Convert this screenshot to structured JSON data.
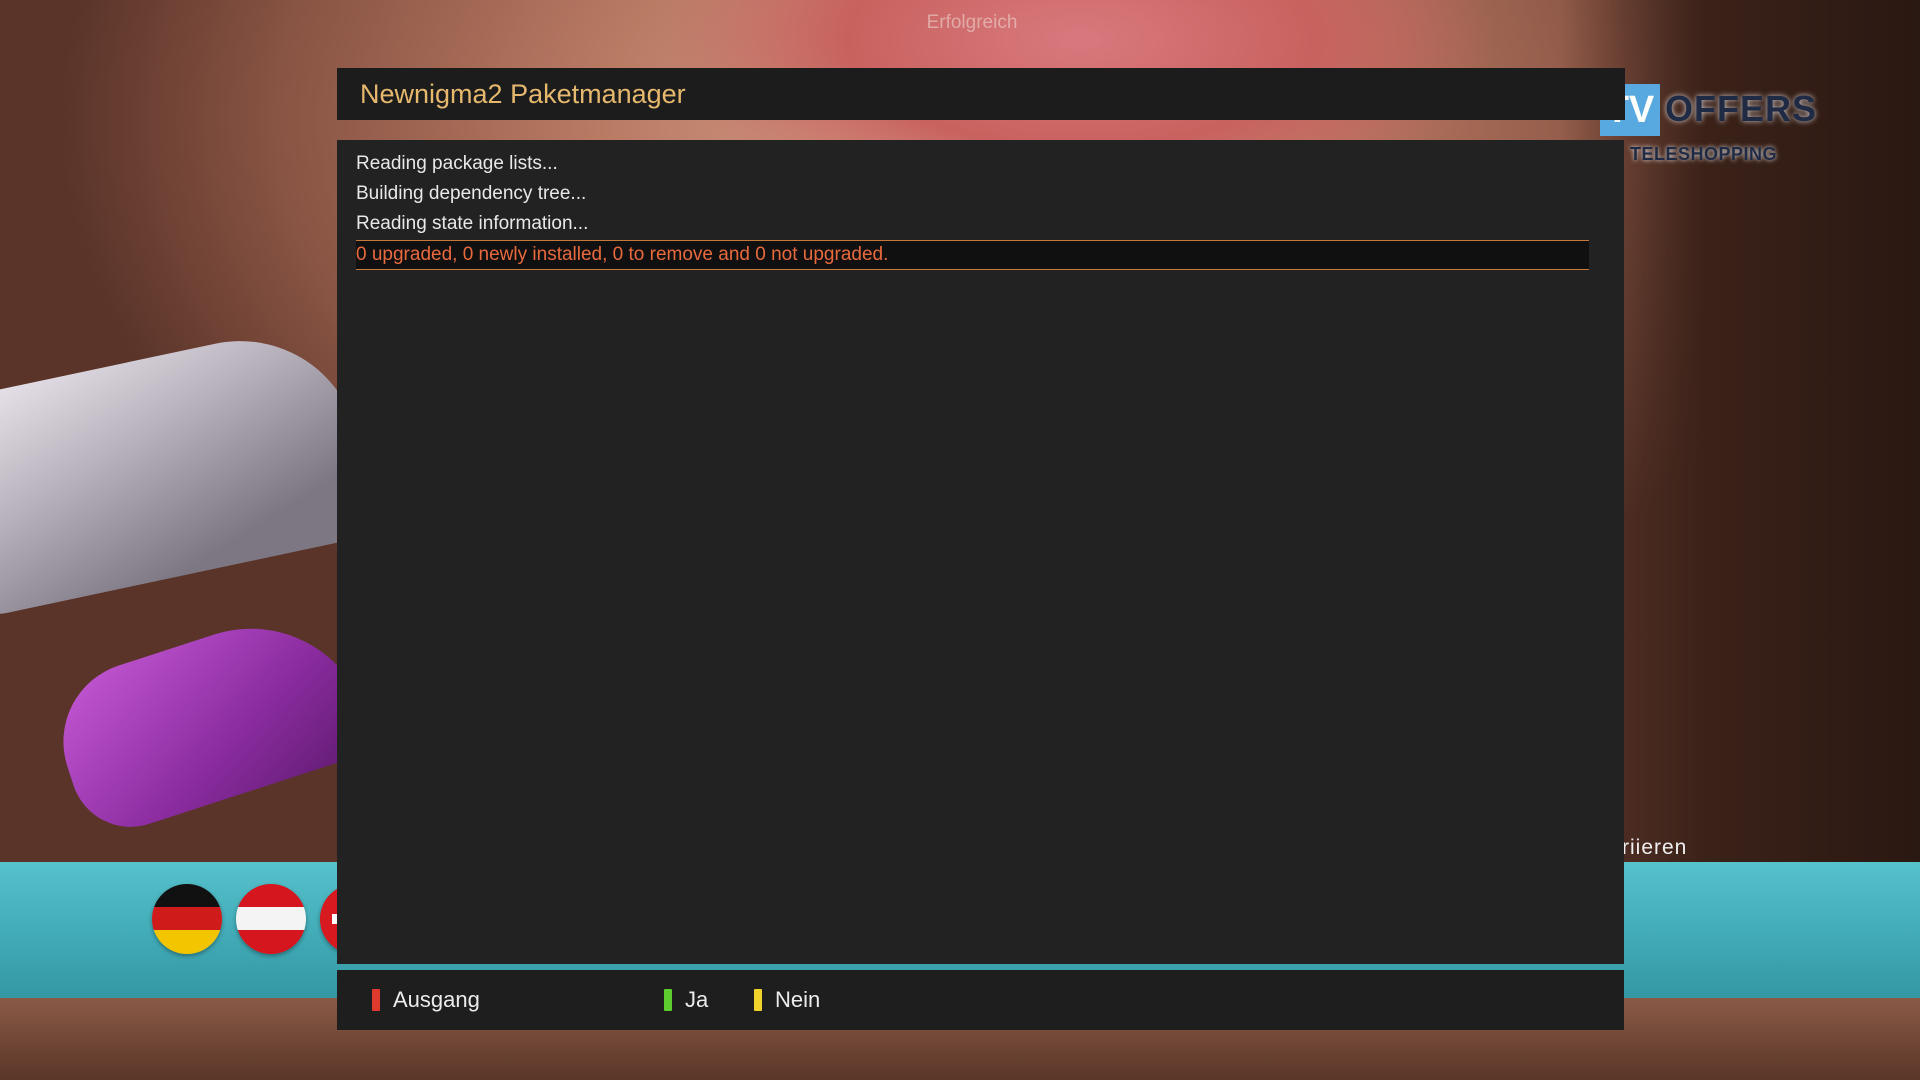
{
  "background": {
    "top_status": "Erfolgreich",
    "channel_logo": {
      "box_text": "TV",
      "word": "OFFERS",
      "sub": "TELESHOPPING"
    },
    "caption_fragment": "riieren"
  },
  "dialog": {
    "title": "Newnigma2 Paketmanager",
    "log_lines": [
      "Reading package lists...",
      "Building dependency tree...",
      "Reading state information...",
      "0 upgraded, 0 newly installed, 0 to remove and 0 not upgraded."
    ],
    "selected_index": 3
  },
  "buttons": {
    "red": {
      "label": "Ausgang",
      "color": "#e03a2e"
    },
    "green": {
      "label": "Ja",
      "color": "#5ccc2f"
    },
    "yellow": {
      "label": "Nein",
      "color": "#f0d22a"
    }
  },
  "colors": {
    "title_text": "#e6b86e",
    "selected_text": "#e86a3c",
    "selection_border": "#c5793a",
    "panel_bg": "#222222"
  }
}
